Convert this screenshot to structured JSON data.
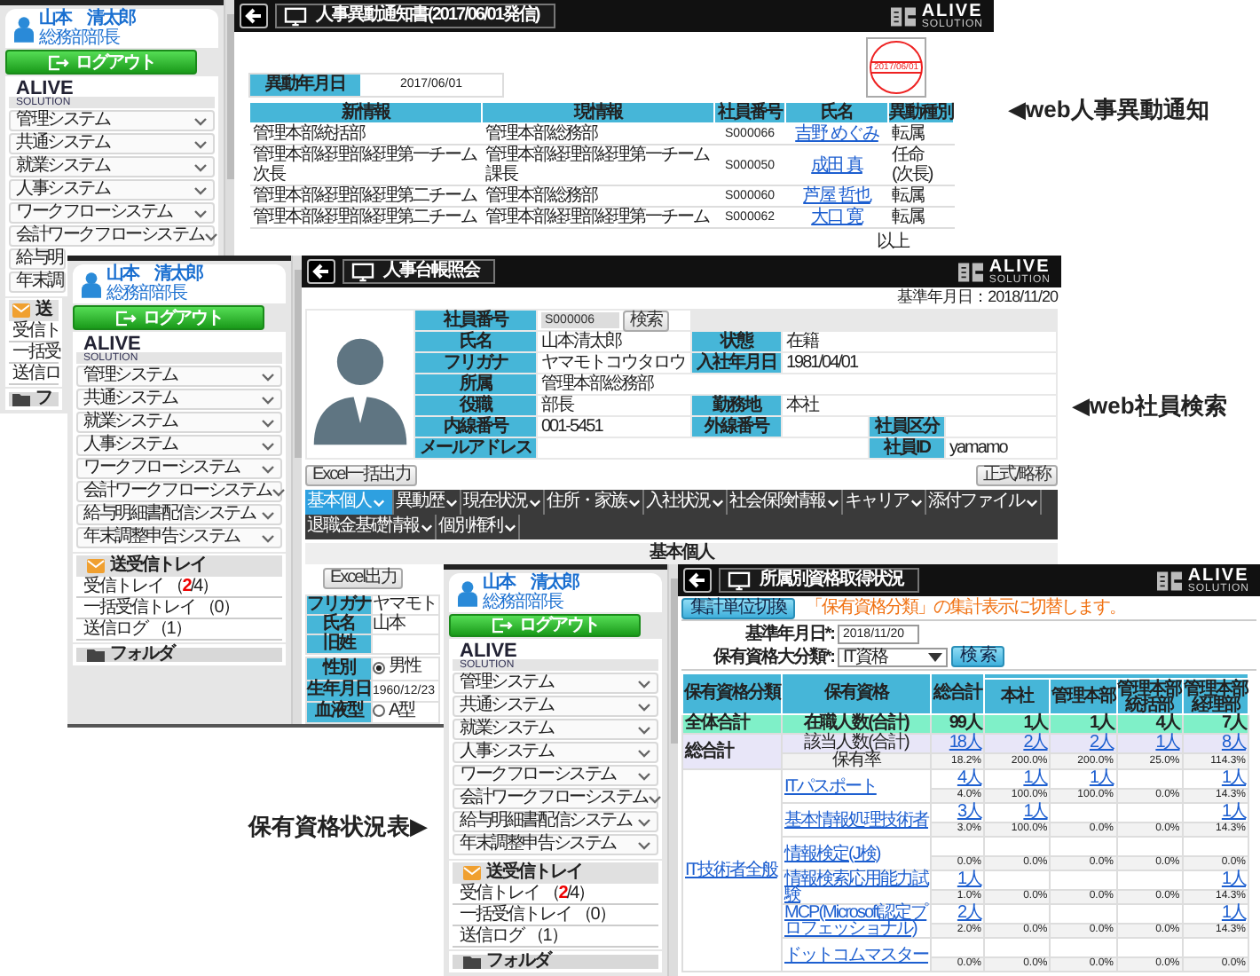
{
  "windows": [
    {
      "kind": "notice",
      "sidebar": {
        "user": {
          "name": "山本　清太郎",
          "title": "総務部部長"
        },
        "logout": "ログアウト",
        "logo": {
          "name": "ALIVE",
          "tagline": "SOLUTION"
        },
        "menu": [
          "管理システム",
          "共通システム",
          "就業システム",
          "人事システム",
          "ワークフローシステム",
          "会計ワークフローシステム"
        ],
        "menu_partial": [
          "給与明",
          "年末調"
        ],
        "tray": {
          "title": "送",
          "items": [
            "受信ト",
            "一括受",
            "送信ロ"
          ]
        },
        "folder": "フ"
      },
      "header": {
        "title": "人事異動通知書(2017/06/01発信)",
        "logo": {
          "name": "ALIVE",
          "tagline": "SOLUTION"
        }
      },
      "stamp": {
        "date": "2017/06/01"
      },
      "date_field": {
        "label": "異動年月日",
        "value": "2017/06/01"
      },
      "table": {
        "columns": [
          "新情報",
          "現情報",
          "社員番号",
          "氏名",
          "異動種別"
        ],
        "rows": [
          {
            "new_info": "管理本部統括部",
            "current_info": "管理本部総務部",
            "employee_no": "S000066",
            "name": "吉野 めぐみ",
            "change_type": "転属"
          },
          {
            "new_info": "管理本部経理部経理第一チーム次長",
            "current_info": "管理本部経理部経理第一チーム課長",
            "employee_no": "S000050",
            "name": "成田 真",
            "change_type": "任命(次長)"
          },
          {
            "new_info": "管理本部経理部経理第二チーム",
            "current_info": "管理本部総務部",
            "employee_no": "S000060",
            "name": "芦屋 哲也",
            "change_type": "転属"
          },
          {
            "new_info": "管理本部経理部経理第二チーム",
            "current_info": "管理本部経理部経理第一チーム",
            "employee_no": "S000062",
            "name": "大口 寛",
            "change_type": "転属"
          }
        ]
      },
      "footer": "以上"
    },
    {
      "kind": "ledger",
      "sidebar": {
        "user": {
          "name": "山本　清太郎",
          "title": "総務部部長"
        },
        "logout": "ログアウト",
        "logo": {
          "name": "ALIVE",
          "tagline": "SOLUTION"
        },
        "menu": [
          "管理システム",
          "共通システム",
          "就業システム",
          "人事システム",
          "ワークフローシステム",
          "会計ワークフローシステム",
          "給与明細書配信システム",
          "年末調整申告システム"
        ],
        "tray": {
          "title": "送受信トレイ",
          "items": [
            "受信トレイ （**2**/4）",
            "一括受信トレイ （0）",
            "送信ログ （1）"
          ]
        },
        "folder": "フォルダ"
      },
      "header": {
        "title": "人事台帳照会",
        "logo": {
          "name": "ALIVE",
          "tagline": "SOLUTION"
        }
      },
      "reference_date": "基準年月日：2018/11/20",
      "employee": {
        "rows": [
          [
            {
              "label": "社員番号",
              "value": "S000006",
              "kind": "lookup",
              "button": "検索"
            }
          ],
          [
            {
              "label": "氏名",
              "value": "山本清太郎",
              "kind": "text"
            },
            {
              "label": "状態",
              "value": "在籍",
              "kind": "text"
            }
          ],
          [
            {
              "label": "フリガナ",
              "value": "ヤマモトコウタロウ",
              "kind": "text"
            },
            {
              "label": "入社年月日",
              "value": "1981/04/01",
              "kind": "text"
            }
          ],
          [
            {
              "label": "所属",
              "value": "管理本部総務部",
              "kind": "text"
            }
          ],
          [
            {
              "label": "役職",
              "value": "部長",
              "kind": "text"
            },
            {
              "label": "勤務地",
              "value": "本社",
              "kind": "text"
            }
          ],
          [
            {
              "label": "内線番号",
              "value": "001-5451",
              "kind": "text"
            },
            {
              "label": "外線番号",
              "kind": "text"
            },
            {
              "label": "社員区分",
              "kind": "text"
            }
          ],
          [
            {
              "label": "メールアドレス",
              "kind": "text"
            },
            null,
            {
              "label": "社員ID",
              "value": "yamamo",
              "kind": "text"
            }
          ]
        ]
      },
      "buttons": {
        "left": "Excel一括出力",
        "right": "正式/略称"
      },
      "tab_rows": [
        [
          {
            "label": "基本個人",
            "selected": true
          },
          {
            "label": "異動歴",
            "selected": false
          },
          {
            "label": "現在状況",
            "selected": false
          },
          {
            "label": "住所・家族",
            "selected": false
          },
          {
            "label": "入社状況",
            "selected": false
          },
          {
            "label": "社会保険情報",
            "selected": false
          },
          {
            "label": "キャリア",
            "selected": false
          },
          {
            "label": "添付ファイル",
            "selected": false
          }
        ],
        [
          {
            "label": "退職金基礎情報",
            "selected": false
          },
          {
            "label": "個別権利",
            "selected": false
          }
        ]
      ],
      "section": {
        "title": "基本個人",
        "export": "Excel出力",
        "names": [
          {
            "label": "フリガナ",
            "value": "ヤマモト"
          },
          {
            "label": "氏名",
            "value": "山本"
          },
          {
            "label": "旧姓"
          }
        ],
        "attributes": [
          {
            "label": "性別",
            "kind": "radio",
            "option": {
              "label": "男性",
              "selected": true
            }
          },
          {
            "label": "生年月日",
            "kind": "text",
            "value": "1960/12/23"
          },
          {
            "label": "血液型",
            "kind": "radio",
            "option": {
              "label": "A型",
              "selected": false
            }
          }
        ]
      }
    },
    {
      "kind": "qualifications",
      "sidebar": {
        "user": {
          "name": "山本　清太郎",
          "title": "総務部部長"
        },
        "logout": "ログアウト",
        "logo": {
          "name": "ALIVE",
          "tagline": "SOLUTION"
        },
        "menu": [
          "管理システム",
          "共通システム",
          "就業システム",
          "人事システム",
          "ワークフローシステム",
          "会計ワークフローシステム",
          "給与明細書配信システム",
          "年末調整申告システム"
        ],
        "tray": {
          "title": "送受信トレイ",
          "items": [
            "受信トレイ （**2**/4）",
            "一括受信トレイ （0）",
            "送信ログ （1）"
          ]
        },
        "folder": "フォルダ"
      },
      "header": {
        "title": "所属別資格取得状況",
        "logo": {
          "name": "ALIVE",
          "tagline": "SOLUTION"
        }
      },
      "toolbar": {
        "button": "集計単位切換",
        "note": "「保有資格分類」の集計表示に切替します。"
      },
      "search": {
        "date_label": "基準年月日*:",
        "date_value": "2018/11/20",
        "category_label": "保有資格大分類*:",
        "category_value": "IT資格",
        "button": "検 索"
      },
      "table": {
        "columns": [
          "保有資格分類",
          "保有資格",
          "総合計"
        ],
        "departments": [
          "本社",
          "管理本部",
          "管理本部統括部",
          "管理本部経理部"
        ],
        "total_row": {
          "label": "全体合計",
          "metric": "在職人数(合計)",
          "values": [
            "99人",
            "1人",
            "1人",
            "4人",
            "7人"
          ]
        },
        "summary": {
          "label": "総合計",
          "count_label": "該当人数(合計)",
          "counts": [
            "18人",
            "2人",
            "2人",
            "1人",
            "8人"
          ],
          "rate_label": "保有率",
          "rates": [
            "18.2%",
            "200.0%",
            "200.0%",
            "25.0%",
            "114.3%"
          ]
        },
        "groups": [
          {
            "category": "IT技術者全般",
            "qualifications": [
              {
                "name": "ITパスポート",
                "counts": {
                  "total": "4人",
                  "dept_1": "1人",
                  "dept_2": "1人",
                  "dept_4": "1人"
                },
                "rates": [
                  "4.0%",
                  "100.0%",
                  "100.0%",
                  "0.0%",
                  "14.3%"
                ]
              },
              {
                "name": "基本情報処理技術者",
                "counts": {
                  "total": "3人",
                  "dept_1": "1人",
                  "dept_4": "1人"
                },
                "rates": [
                  "3.0%",
                  "100.0%",
                  "0.0%",
                  "0.0%",
                  "14.3%"
                ]
              },
              {
                "name": "情報検定(J検)",
                "rates": [
                  "0.0%",
                  "0.0%",
                  "0.0%",
                  "0.0%",
                  "0.0%"
                ]
              },
              {
                "name": "情報検索応用能力試験",
                "counts": {
                  "total": "1人",
                  "dept_4": "1人"
                },
                "rates": [
                  "1.0%",
                  "0.0%",
                  "0.0%",
                  "0.0%",
                  "14.3%"
                ]
              },
              {
                "name": "MCP(Microsoft認定プロフェッショナル)",
                "counts": {
                  "total": "2人",
                  "dept_4": "1人"
                },
                "rates": [
                  "2.0%",
                  "0.0%",
                  "0.0%",
                  "0.0%",
                  "14.3%"
                ]
              },
              {
                "name": "ドットコムマスター",
                "rates": [
                  "0.0%",
                  "0.0%",
                  "0.0%",
                  "0.0%",
                  "0.0%"
                ]
              }
            ]
          }
        ]
      }
    }
  ],
  "captions": [
    "◀web人事異動通知",
    "◀web社員検索",
    "保有資格状況表▶"
  ]
}
